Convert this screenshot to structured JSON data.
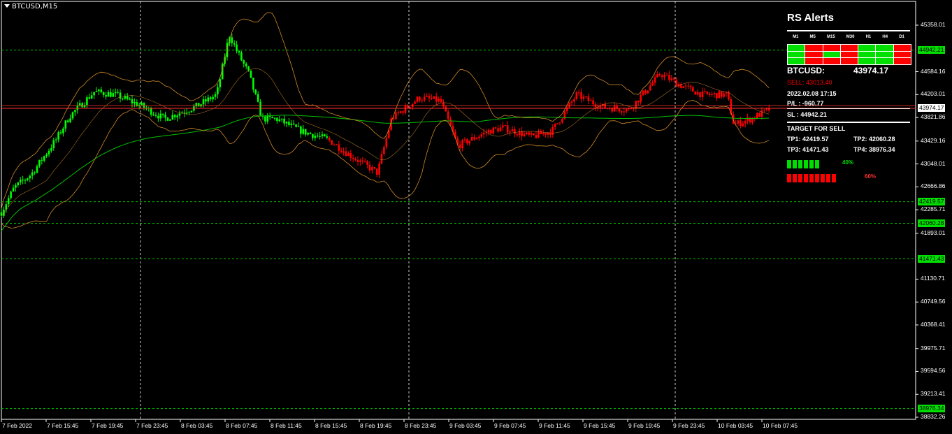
{
  "symbol": "BTCUSD,M15",
  "price_axis": {
    "labels": [
      "45358.01",
      "44584.16",
      "44203.01",
      "43821.86",
      "43429.16",
      "43048.01",
      "42666.86",
      "42285.71",
      "41893.01",
      "41130.71",
      "40749.56",
      "40368.41",
      "39975.71",
      "39594.56",
      "39213.41",
      "38832.26"
    ],
    "label_prices": [
      45358.01,
      44584.16,
      44203.01,
      43821.86,
      43429.16,
      43048.01,
      42666.86,
      42285.71,
      41893.01,
      41130.71,
      40749.56,
      40368.41,
      39975.71,
      39594.56,
      39213.41,
      38832.26
    ],
    "tags": [
      {
        "text": "44942.21",
        "price": 44942.21,
        "bg": "#00e000",
        "fg": "#000"
      },
      {
        "text": "43974.17",
        "price": 43974.17,
        "bg": "#ffffff",
        "fg": "#000"
      },
      {
        "text": "42419.57",
        "price": 42419.57,
        "bg": "#00e000",
        "fg": "#000"
      },
      {
        "text": "42060.28",
        "price": 42060.28,
        "bg": "#00e000",
        "fg": "#000"
      },
      {
        "text": "41471.43",
        "price": 41471.43,
        "bg": "#00e000",
        "fg": "#000"
      },
      {
        "text": "38976.34",
        "price": 38976.34,
        "bg": "#00e000",
        "fg": "#000"
      }
    ]
  },
  "time_axis": {
    "labels": [
      "7 Feb 2022",
      "7 Feb 15:45",
      "7 Feb 19:45",
      "7 Feb 23:45",
      "8 Feb 03:45",
      "8 Feb 07:45",
      "8 Feb 11:45",
      "8 Feb 15:45",
      "8 Feb 19:45",
      "8 Feb 23:45",
      "9 Feb 03:45",
      "9 Feb 07:45",
      "9 Feb 11:45",
      "9 Feb 15:45",
      "9 Feb 19:45",
      "9 Feb 23:45",
      "10 Feb 03:45",
      "10 Feb 07:45"
    ]
  },
  "levels": [
    {
      "name": "SL",
      "price": 44942.21,
      "color": "#00c000"
    },
    {
      "name": "TP1",
      "price": 42419.57,
      "color": "#00c000"
    },
    {
      "name": "TP2",
      "price": 42060.28,
      "color": "#00c000"
    },
    {
      "name": "TP3",
      "price": 41471.43,
      "color": "#00c000"
    },
    {
      "name": "TP4",
      "price": 38976.34,
      "color": "#00c000"
    }
  ],
  "current_price": 43974.17,
  "sell_entry": 43013.4,
  "colors": {
    "bull": "#00ff00",
    "bear": "#ff0000",
    "ma": "#00c000",
    "bands": "#d08a2a",
    "panel_green": "#00e000",
    "panel_red": "#ff0000"
  },
  "panel": {
    "title": "RS Alerts",
    "timeframes": [
      "M1",
      "M5",
      "M15",
      "M30",
      "H1",
      "H4",
      "D1"
    ],
    "grid": [
      [
        "g",
        "r",
        "r",
        "r",
        "g",
        "g",
        "r"
      ],
      [
        "g",
        "r",
        "g",
        "r",
        "g",
        "g",
        "r"
      ],
      [
        "g",
        "r",
        "r",
        "r",
        "g",
        "g",
        "r"
      ]
    ],
    "pair_label": "BTCUSD:",
    "pair_price": "43974.17",
    "sell_text": "SELL: 43013.40",
    "datetime": "2022.02.08 17:15",
    "pl_text": "P/L : -960.77",
    "sl_text": "SL : 44942.21",
    "target_title": "TARGET FOR SELL",
    "tp1": "TP1: 42419.57",
    "tp2": "TP2: 42060.28",
    "tp3": "TP3: 41471.43",
    "tp4": "TP4: 38976.34",
    "green_pct": "40%",
    "red_pct": "60%",
    "green_value": 0.4,
    "red_value": 0.6
  }
}
